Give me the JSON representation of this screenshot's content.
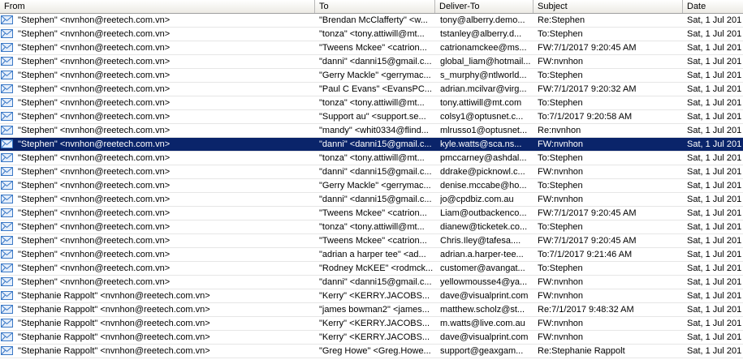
{
  "columns": [
    {
      "key": "from",
      "label": "From"
    },
    {
      "key": "to",
      "label": "To"
    },
    {
      "key": "deliver",
      "label": "Deliver-To"
    },
    {
      "key": "subject",
      "label": "Subject"
    },
    {
      "key": "date",
      "label": "Date"
    }
  ],
  "icon": "envelope-icon",
  "selected_row": 9,
  "colors": {
    "selection": "#0a246a",
    "icon_blue": "#3a78c6"
  },
  "rows": [
    {
      "from": "\"Stephen\" <nvnhon@reetech.com.vn>",
      "to": "\"Brendan McClafferty\" <w...",
      "deliver": "tony@alberry.demo...",
      "subject": "Re:Stephen",
      "date": "Sat, 1 Jul 201"
    },
    {
      "from": "\"Stephen\" <nvnhon@reetech.com.vn>",
      "to": "\"tonza\" <tony.attiwill@mt...",
      "deliver": "tstanley@alberry.d...",
      "subject": "To:Stephen",
      "date": "Sat, 1 Jul 201"
    },
    {
      "from": "\"Stephen\" <nvnhon@reetech.com.vn>",
      "to": "\"Tweens Mckee\" <catrion...",
      "deliver": "catrionamckee@ms...",
      "subject": "FW:7/1/2017 9:20:45 AM",
      "date": "Sat, 1 Jul 201"
    },
    {
      "from": "\"Stephen\" <nvnhon@reetech.com.vn>",
      "to": "\"danni\" <danni15@gmail.c...",
      "deliver": "global_liam@hotmail...",
      "subject": "FW:nvnhon",
      "date": "Sat, 1 Jul 201"
    },
    {
      "from": "\"Stephen\" <nvnhon@reetech.com.vn>",
      "to": "\"Gerry Mackle\" <gerrymac...",
      "deliver": "s_murphy@ntlworld...",
      "subject": "To:Stephen",
      "date": "Sat, 1 Jul 201"
    },
    {
      "from": "\"Stephen\" <nvnhon@reetech.com.vn>",
      "to": "\"Paul C Evans\" <EvansPC...",
      "deliver": "adrian.mcilvar@virg...",
      "subject": "FW:7/1/2017 9:20:32 AM",
      "date": "Sat, 1 Jul 201"
    },
    {
      "from": "\"Stephen\" <nvnhon@reetech.com.vn>",
      "to": "\"tonza\" <tony.attiwill@mt...",
      "deliver": "tony.attiwill@mt.com",
      "subject": "To:Stephen",
      "date": "Sat, 1 Jul 201"
    },
    {
      "from": "\"Stephen\" <nvnhon@reetech.com.vn>",
      "to": "\"Support au\" <support.se...",
      "deliver": "colsy1@optusnet.c...",
      "subject": "To:7/1/2017 9:20:58 AM",
      "date": "Sat, 1 Jul 201"
    },
    {
      "from": "\"Stephen\" <nvnhon@reetech.com.vn>",
      "to": "\"mandy\" <whit0334@flind...",
      "deliver": "mlrusso1@optusnet...",
      "subject": "Re:nvnhon",
      "date": "Sat, 1 Jul 201"
    },
    {
      "from": "\"Stephen\" <nvnhon@reetech.com.vn>",
      "to": "\"danni\" <danni15@gmail.c...",
      "deliver": "kyle.watts@sca.ns...",
      "subject": "FW:nvnhon",
      "date": "Sat, 1 Jul 201"
    },
    {
      "from": "\"Stephen\" <nvnhon@reetech.com.vn>",
      "to": "\"tonza\" <tony.attiwill@mt...",
      "deliver": "pmccarney@ashdal...",
      "subject": "To:Stephen",
      "date": "Sat, 1 Jul 201"
    },
    {
      "from": "\"Stephen\" <nvnhon@reetech.com.vn>",
      "to": "\"danni\" <danni15@gmail.c...",
      "deliver": "ddrake@picknowl.c...",
      "subject": "FW:nvnhon",
      "date": "Sat, 1 Jul 201"
    },
    {
      "from": "\"Stephen\" <nvnhon@reetech.com.vn>",
      "to": "\"Gerry Mackle\" <gerrymac...",
      "deliver": "denise.mccabe@ho...",
      "subject": "To:Stephen",
      "date": "Sat, 1 Jul 201"
    },
    {
      "from": "\"Stephen\" <nvnhon@reetech.com.vn>",
      "to": "\"danni\" <danni15@gmail.c...",
      "deliver": "jo@cpdbiz.com.au",
      "subject": "FW:nvnhon",
      "date": "Sat, 1 Jul 201"
    },
    {
      "from": "\"Stephen\" <nvnhon@reetech.com.vn>",
      "to": "\"Tweens Mckee\" <catrion...",
      "deliver": "Liam@outbackenco...",
      "subject": "FW:7/1/2017 9:20:45 AM",
      "date": "Sat, 1 Jul 201"
    },
    {
      "from": "\"Stephen\" <nvnhon@reetech.com.vn>",
      "to": "\"tonza\" <tony.attiwill@mt...",
      "deliver": "dianew@ticketek.co...",
      "subject": "To:Stephen",
      "date": "Sat, 1 Jul 201"
    },
    {
      "from": "\"Stephen\" <nvnhon@reetech.com.vn>",
      "to": "\"Tweens Mckee\" <catrion...",
      "deliver": "Chris.Iley@tafesa....",
      "subject": "FW:7/1/2017 9:20:45 AM",
      "date": "Sat, 1 Jul 201"
    },
    {
      "from": "\"Stephen\" <nvnhon@reetech.com.vn>",
      "to": "\"adrian a harper tee\" <ad...",
      "deliver": "adrian.a.harper-tee...",
      "subject": "To:7/1/2017 9:21:46 AM",
      "date": "Sat, 1 Jul 201"
    },
    {
      "from": "\"Stephen\" <nvnhon@reetech.com.vn>",
      "to": "\"Rodney McKEE\" <rodmck...",
      "deliver": "customer@avangat...",
      "subject": "To:Stephen",
      "date": "Sat, 1 Jul 201"
    },
    {
      "from": "\"Stephen\" <nvnhon@reetech.com.vn>",
      "to": "\"danni\" <danni15@gmail.c...",
      "deliver": "yellowmousse4@ya...",
      "subject": "FW:nvnhon",
      "date": "Sat, 1 Jul 201"
    },
    {
      "from": "\"Stephanie Rappolt\" <nvnhon@reetech.com.vn>",
      "to": "\"Kerry\" <KERRY.JACOBS...",
      "deliver": "dave@visualprint.com",
      "subject": "FW:nvnhon",
      "date": "Sat, 1 Jul 201"
    },
    {
      "from": "\"Stephanie Rappolt\" <nvnhon@reetech.com.vn>",
      "to": "\"james bowman2\" <james...",
      "deliver": "matthew.scholz@st...",
      "subject": "Re:7/1/2017 9:48:32 AM",
      "date": "Sat, 1 Jul 201"
    },
    {
      "from": "\"Stephanie Rappolt\" <nvnhon@reetech.com.vn>",
      "to": "\"Kerry\" <KERRY.JACOBS...",
      "deliver": "m.watts@live.com.au",
      "subject": "FW:nvnhon",
      "date": "Sat, 1 Jul 201"
    },
    {
      "from": "\"Stephanie Rappolt\" <nvnhon@reetech.com.vn>",
      "to": "\"Kerry\" <KERRY.JACOBS...",
      "deliver": "dave@visualprint.com",
      "subject": "FW:nvnhon",
      "date": "Sat, 1 Jul 201"
    },
    {
      "from": "\"Stephanie Rappolt\" <nvnhon@reetech.com.vn>",
      "to": "\"Greg Howe\" <Greg.Howe...",
      "deliver": "support@geaxgam...",
      "subject": "Re:Stephanie Rappolt",
      "date": "Sat, 1 Jul 201"
    }
  ]
}
